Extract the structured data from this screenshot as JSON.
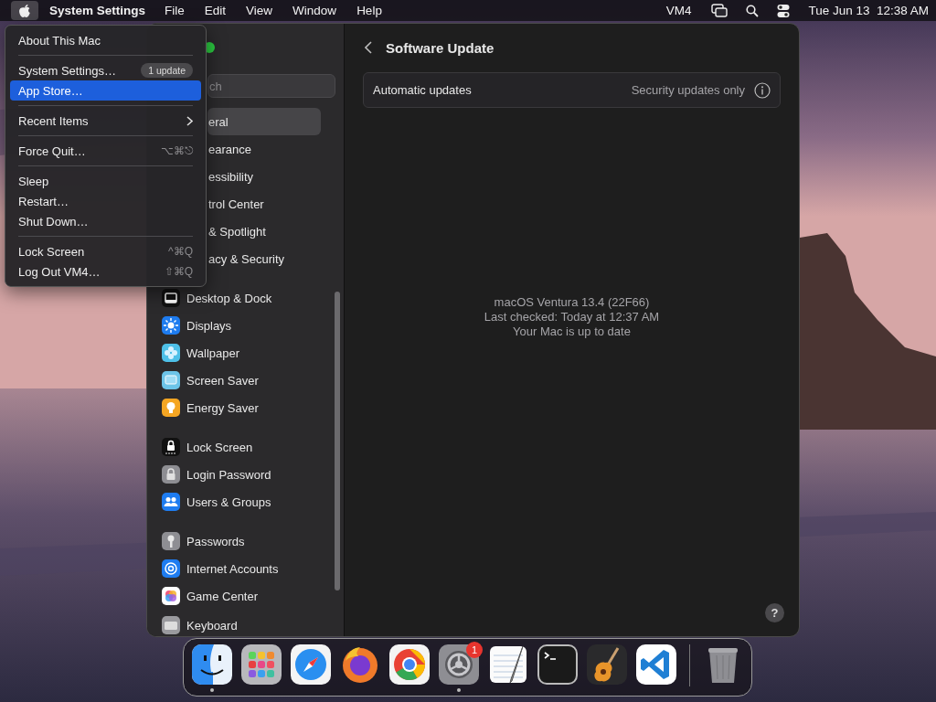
{
  "menu_bar": {
    "app_name": "System Settings",
    "menus": [
      "File",
      "Edit",
      "View",
      "Window",
      "Help"
    ],
    "user": "VM4",
    "clock": "Tue Jun 13  12:38 AM"
  },
  "apple_menu": {
    "items": [
      {
        "kind": "item",
        "label": "About This Mac",
        "selected": false
      },
      {
        "kind": "separator"
      },
      {
        "kind": "item",
        "label": "System Settings…",
        "badge": "1 update",
        "selected": false
      },
      {
        "kind": "item",
        "label": "App Store…",
        "selected": true
      },
      {
        "kind": "separator"
      },
      {
        "kind": "submenu",
        "label": "Recent Items",
        "selected": false
      },
      {
        "kind": "separator"
      },
      {
        "kind": "item",
        "label": "Force Quit…",
        "shortcut": "⌥⌘⎋",
        "selected": false
      },
      {
        "kind": "separator"
      },
      {
        "kind": "item",
        "label": "Sleep",
        "selected": false
      },
      {
        "kind": "item",
        "label": "Restart…",
        "selected": false
      },
      {
        "kind": "item",
        "label": "Shut Down…",
        "selected": false
      },
      {
        "kind": "separator"
      },
      {
        "kind": "item",
        "label": "Lock Screen",
        "shortcut": "^⌘Q",
        "selected": false
      },
      {
        "kind": "item",
        "label": "Log Out VM4…",
        "shortcut": "⇧⌘Q",
        "selected": false
      }
    ]
  },
  "sidebar": {
    "search": {
      "placeholder": "ch"
    },
    "groups": [
      [
        {
          "label": "eral",
          "selected": true
        },
        {
          "label": "earance",
          "selected": false
        },
        {
          "label": "essibility",
          "selected": false
        },
        {
          "label": "trol Center",
          "selected": false
        },
        {
          "label": "& Spotlight",
          "selected": false
        },
        {
          "label": "acy & Security",
          "selected": false
        }
      ],
      [
        {
          "label": "Desktop & Dock",
          "selected": false
        },
        {
          "label": "Displays",
          "selected": false
        },
        {
          "label": "Wallpaper",
          "selected": false
        },
        {
          "label": "Screen Saver",
          "selected": false
        },
        {
          "label": "Energy Saver",
          "selected": false
        }
      ],
      [
        {
          "label": "Lock Screen",
          "selected": false
        },
        {
          "label": "Login Password",
          "selected": false
        },
        {
          "label": "Users & Groups",
          "selected": false
        }
      ],
      [
        {
          "label": "Passwords",
          "selected": false
        },
        {
          "label": "Internet Accounts",
          "selected": false
        },
        {
          "label": "Game Center",
          "selected": false
        }
      ],
      [
        {
          "label": "Keyboard",
          "selected": false
        }
      ]
    ]
  },
  "content": {
    "title": "Software Update",
    "automatic_updates": {
      "label": "Automatic updates",
      "value": "Security updates only"
    },
    "status": [
      "macOS Ventura 13.4 (22F66)",
      "Last checked: Today at 12:37 AM",
      "Your Mac is up to date"
    ],
    "help": "?"
  },
  "dock": {
    "apps": [
      {
        "kind": "finder",
        "running": true
      },
      {
        "kind": "launchpad",
        "running": false
      },
      {
        "kind": "safari",
        "running": false
      },
      {
        "kind": "firefox",
        "running": false
      },
      {
        "kind": "chrome",
        "running": false
      },
      {
        "kind": "settings",
        "running": true,
        "badge": "1"
      },
      {
        "kind": "textedit",
        "running": false
      },
      {
        "kind": "terminal",
        "running": false
      },
      {
        "kind": "garageband",
        "running": false
      },
      {
        "kind": "vscode",
        "running": false
      },
      {
        "kind": "separator"
      },
      {
        "kind": "trash",
        "running": false
      }
    ]
  }
}
